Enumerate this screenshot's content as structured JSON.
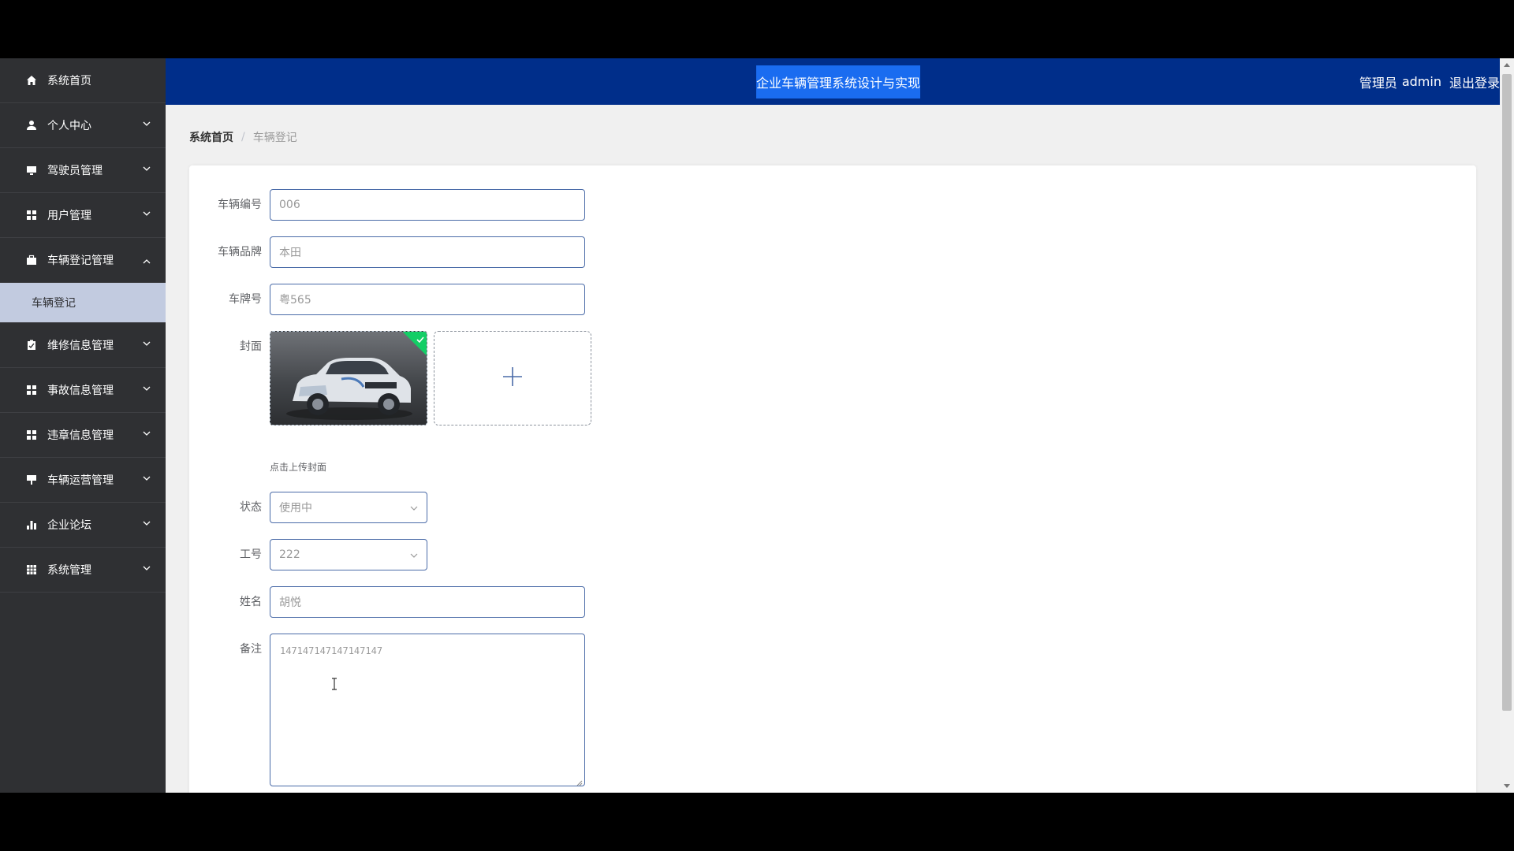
{
  "header": {
    "title": "企业车辆管理系统设计与实现",
    "role": "管理员",
    "username": "admin",
    "logout": "退出登录"
  },
  "sidebar": {
    "items": [
      {
        "label": "系统首页",
        "icon": "home-icon"
      },
      {
        "label": "个人中心",
        "icon": "user-icon"
      },
      {
        "label": "驾驶员管理",
        "icon": "monitor-icon"
      },
      {
        "label": "用户管理",
        "icon": "grid-icon"
      },
      {
        "label": "车辆登记管理",
        "icon": "briefcase-icon"
      },
      {
        "label": "维修信息管理",
        "icon": "clipboard-icon"
      },
      {
        "label": "事故信息管理",
        "icon": "grid-icon"
      },
      {
        "label": "违章信息管理",
        "icon": "grid-icon"
      },
      {
        "label": "车辆运营管理",
        "icon": "sign-icon"
      },
      {
        "label": "企业论坛",
        "icon": "bar-chart-icon"
      },
      {
        "label": "系统管理",
        "icon": "table-icon"
      }
    ],
    "submenu": {
      "label": "车辆登记"
    }
  },
  "breadcrumb": {
    "home": "系统首页",
    "separator": "/",
    "current": "车辆登记"
  },
  "form": {
    "vehicle_no": {
      "label": "车辆编号",
      "value": "006"
    },
    "brand": {
      "label": "车辆品牌",
      "value": "本田"
    },
    "plate": {
      "label": "车牌号",
      "value": "粤565"
    },
    "cover": {
      "label": "封面",
      "tip": "点击上传封面"
    },
    "status": {
      "label": "状态",
      "value": "使用中"
    },
    "job_no": {
      "label": "工号",
      "value": "222"
    },
    "name": {
      "label": "姓名",
      "value": "胡悦"
    },
    "remark": {
      "label": "备注",
      "value": "147147147147147147"
    }
  },
  "colors": {
    "header_bg": "#002e8a",
    "title_highlight": "#1a6cf0",
    "sidebar_bg": "#2f3033",
    "submenu_bg": "#c2cbe0",
    "upload_success": "#13ce66"
  }
}
